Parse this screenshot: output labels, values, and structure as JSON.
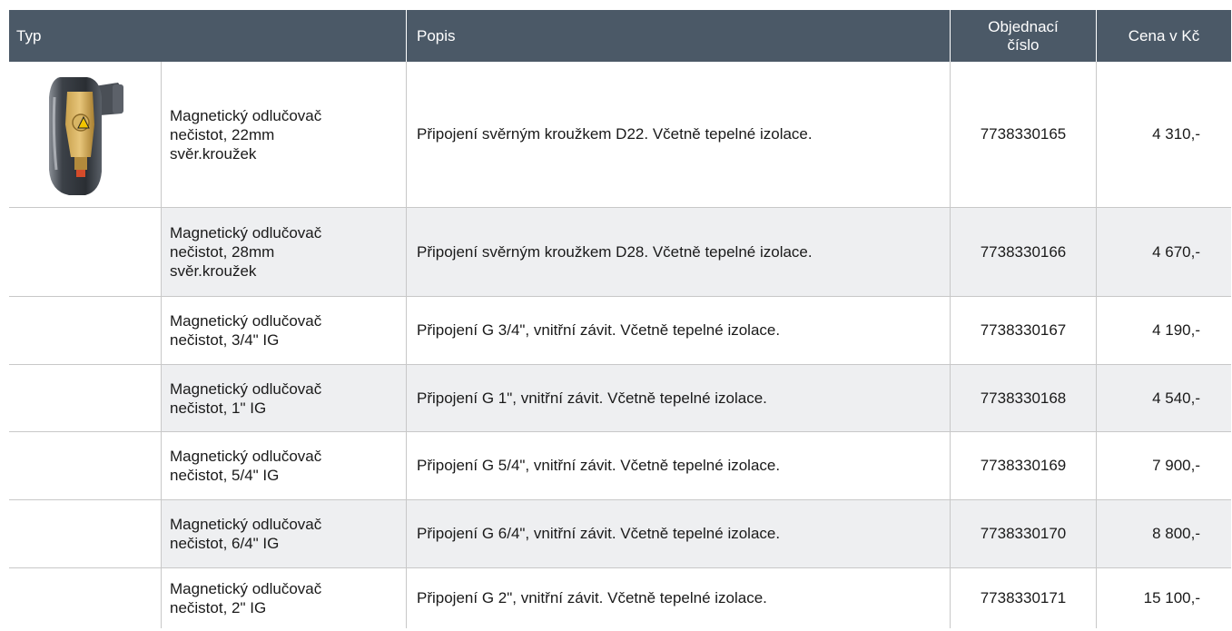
{
  "header": {
    "typ": "Typ",
    "popis": "Popis",
    "objednaci_line1": "Objednací",
    "objednaci_line2": "číslo",
    "cena": "Cena v Kč"
  },
  "rows": [
    {
      "name_lines": [
        "Magnetický odlučovač",
        "nečistot, 22mm",
        "svěr.kroužek"
      ],
      "description": "Připojení svěrným kroužkem D22. Včetně tepelné izolace.",
      "order_number": "7738330165",
      "price": "4 310,-",
      "has_image": true,
      "image_icon": "magnetic-separator-image"
    },
    {
      "name_lines": [
        "Magnetický odlučovač",
        "nečistot, 28mm",
        "svěr.kroužek"
      ],
      "description": "Připojení svěrným kroužkem D28. Včetně tepelné izolace.",
      "order_number": "7738330166",
      "price": "4 670,-"
    },
    {
      "name_lines": [
        "Magnetický odlučovač",
        "nečistot, 3/4\" IG"
      ],
      "description": "Připojení G 3/4\", vnitřní závit. Včetně tepelné izolace.",
      "order_number": "7738330167",
      "price": "4 190,-"
    },
    {
      "name_lines": [
        "Magnetický odlučovač",
        "nečistot, 1\" IG"
      ],
      "description": "Připojení G 1\", vnitřní závit. Včetně tepelné izolace.",
      "order_number": "7738330168",
      "price": "4 540,-"
    },
    {
      "name_lines": [
        "Magnetický odlučovač",
        "nečistot, 5/4\" IG"
      ],
      "description": "Připojení G 5/4\", vnitřní závit. Včetně tepelné izolace.",
      "order_number": "7738330169",
      "price": "7 900,-"
    },
    {
      "name_lines": [
        "Magnetický odlučovač",
        "nečistot, 6/4\" IG"
      ],
      "description": "Připojení G 6/4\", vnitřní závit. Včetně tepelné izolace.",
      "order_number": "7738330170",
      "price": "8 800,-"
    },
    {
      "name_lines": [
        "Magnetický odlučovač",
        "nečistot, 2\" IG"
      ],
      "description": "Připojení G 2\", vnitřní závit. Včetně tepelné izolace.",
      "order_number": "7738330171",
      "price": "15 100,-"
    }
  ],
  "colors": {
    "header_bg": "#4b5967",
    "alt_row_bg": "#eeeff1",
    "border": "#c8c8c8"
  }
}
